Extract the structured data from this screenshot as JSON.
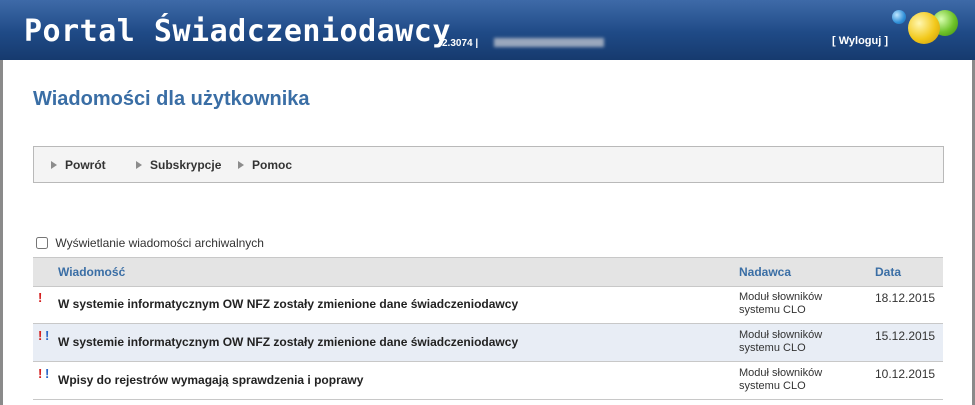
{
  "header": {
    "title": "Portal Świadczeniodawcy",
    "version": "2.3074 |",
    "logout": "[ Wyloguj ]"
  },
  "page": {
    "title": "Wiadomości dla użytkownika"
  },
  "toolbar": {
    "items": [
      "Powrót",
      "Subskrypcje",
      "Pomoc"
    ]
  },
  "archive": {
    "label": "Wyświetlanie wiadomości archiwalnych",
    "checked": false
  },
  "table": {
    "columns": [
      "Wiadomość",
      "Nadawca",
      "Data"
    ],
    "rows": [
      {
        "marks": "!",
        "subject": "W systemie informatycznym OW NFZ zostały zmienione dane świadczeniodawcy",
        "sender": "Moduł słowników systemu CLO",
        "date": "18.12.2015"
      },
      {
        "marks": "!!",
        "subject": "W systemie informatycznym OW NFZ zostały zmienione dane świadczeniodawcy",
        "sender": "Moduł słowników systemu CLO",
        "date": "15.12.2015"
      },
      {
        "marks": "!!",
        "subject": "Wpisy do rejestrów wymagają sprawdzenia i poprawy",
        "sender": "Moduł słowników systemu CLO",
        "date": "10.12.2015"
      }
    ]
  },
  "colors": {
    "header": "#1f4a86",
    "accent": "#3a6ea5",
    "priority_red": "#d42020",
    "priority_blue": "#2a66c8"
  }
}
